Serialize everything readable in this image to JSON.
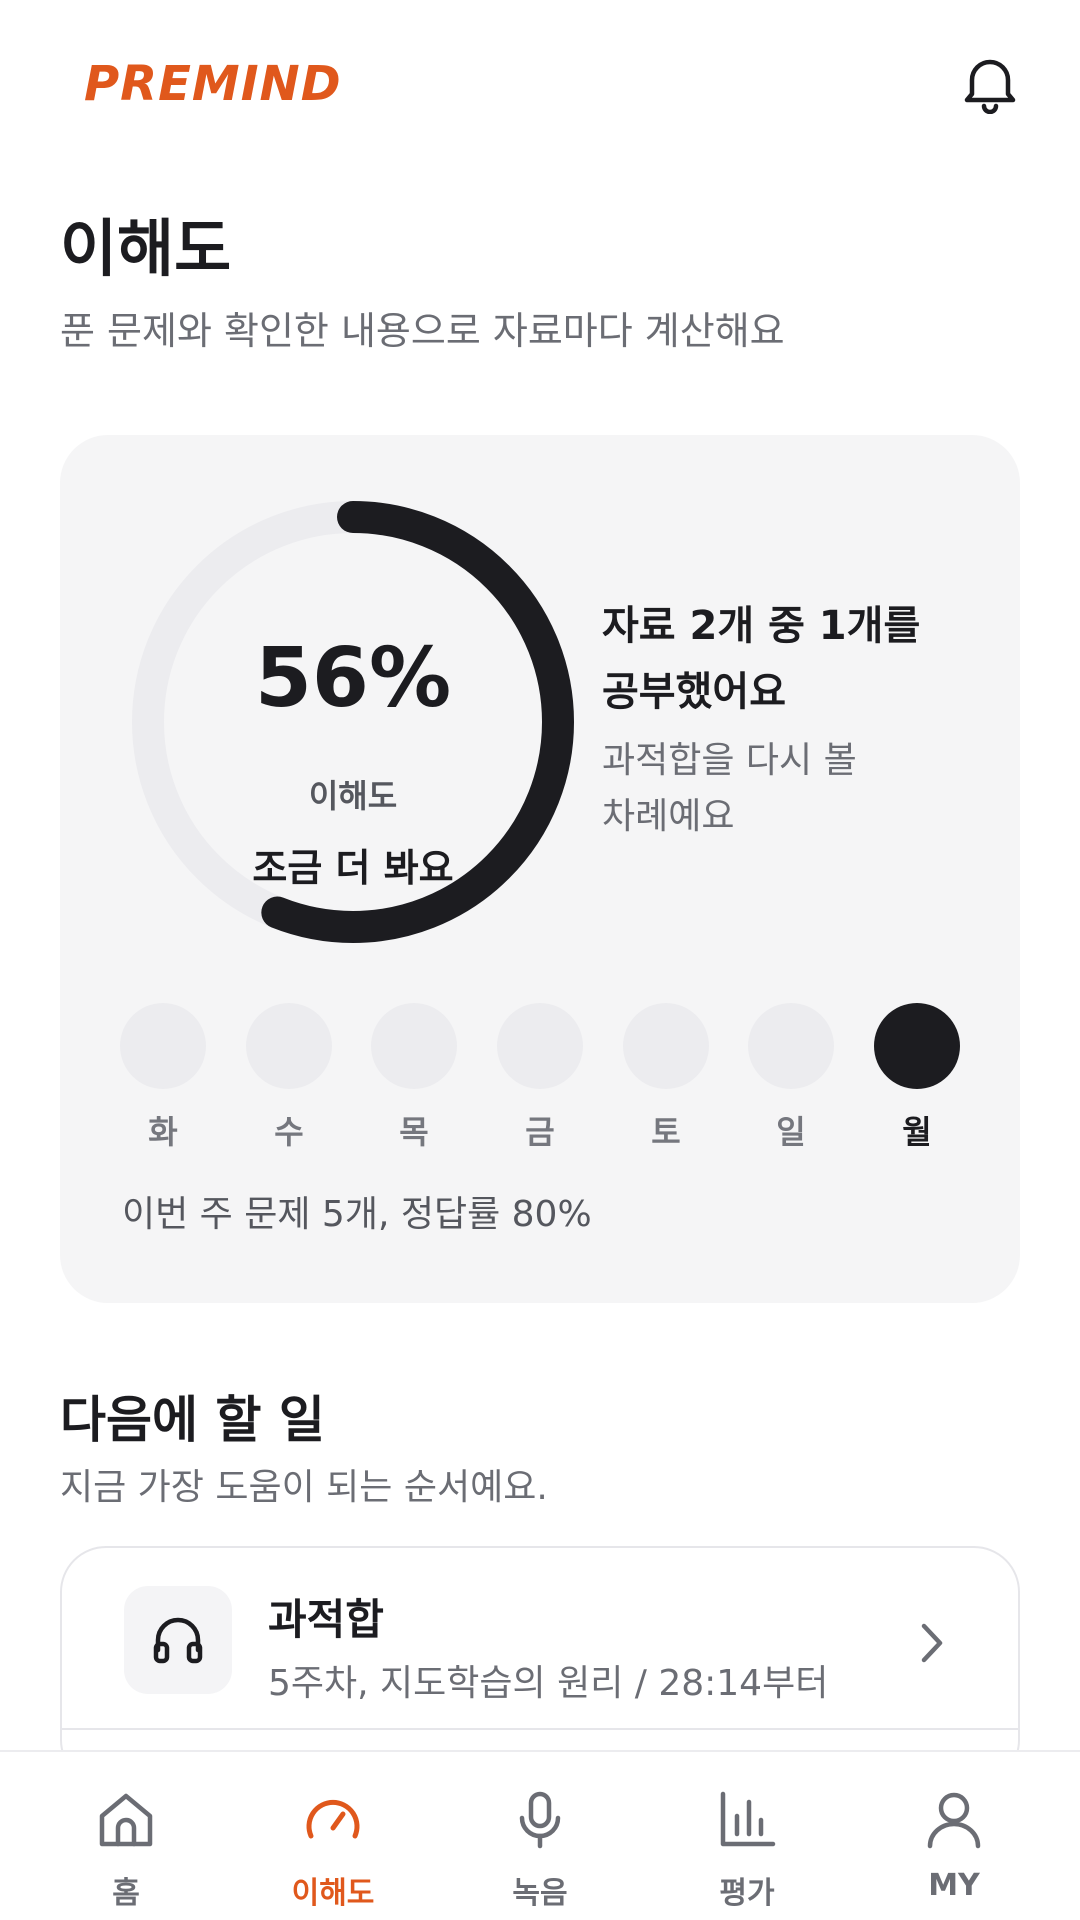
{
  "header": {
    "logo_text": "PREMIND",
    "notification_icon": "bell-icon"
  },
  "page": {
    "title": "이해도",
    "subtitle": "푼 문제와 확인한 내용으로 자료마다 계산해요"
  },
  "understanding_card": {
    "progress_value": 0.56,
    "percent_text": "56%",
    "label": "이해도",
    "status": "조금 더 봐요",
    "headline_line1": "자료 2개 중 1개를",
    "headline_line2": "공부했어요",
    "sub_line1": "과적합을 다시 볼",
    "sub_line2": "차례예요",
    "week": [
      {
        "label": "화",
        "active": false
      },
      {
        "label": "수",
        "active": false
      },
      {
        "label": "목",
        "active": false
      },
      {
        "label": "금",
        "active": false
      },
      {
        "label": "토",
        "active": false
      },
      {
        "label": "일",
        "active": false
      },
      {
        "label": "월",
        "active": true
      }
    ],
    "week_summary": "이번 주 문제 5개, 정답률 80%"
  },
  "next_tasks": {
    "title": "다음에 할 일",
    "subtitle": "지금 가장 도움이 되는 순서예요.",
    "items": [
      {
        "title": "과적합",
        "meta": "5주차, 지도학습의 원리 / 28:14부터",
        "icon": "headphones-icon"
      }
    ]
  },
  "bottom_nav": {
    "items": [
      {
        "label": "홈",
        "icon": "home-icon",
        "active": false
      },
      {
        "label": "이해도",
        "icon": "gauge-icon",
        "active": true
      },
      {
        "label": "녹음",
        "icon": "microphone-icon",
        "active": false
      },
      {
        "label": "평가",
        "icon": "bar-chart-icon",
        "active": false
      },
      {
        "label": "MY",
        "icon": "user-icon",
        "active": false
      }
    ]
  },
  "colors": {
    "accent": "#e0581c",
    "ring_fill": "#1c1c20",
    "ring_track": "#ececef"
  }
}
